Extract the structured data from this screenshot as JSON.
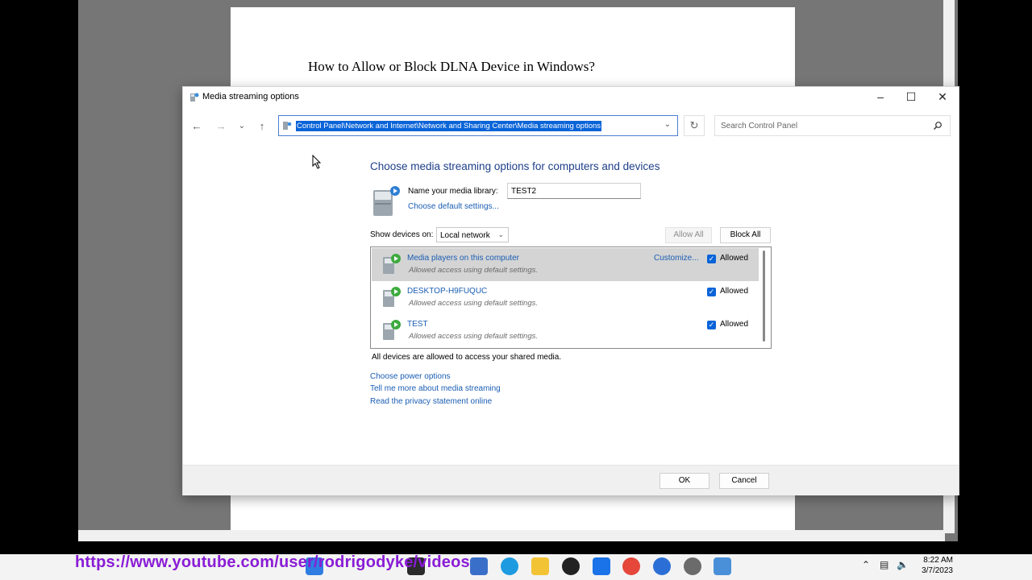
{
  "background_document": {
    "title": "How to Allow or Block DLNA Device in Windows?"
  },
  "dialog": {
    "title": "Media streaming options",
    "address": "Control Panel\\Network and Internet\\Network and Sharing Center\\Media streaming options",
    "search_placeholder": "Search Control Panel",
    "heading": "Choose media streaming options for computers and devices",
    "library_label": "Name your media library:",
    "library_value": "TEST2",
    "choose_default_link": "Choose default settings...",
    "show_devices_label": "Show devices on:",
    "show_devices_value": "Local network",
    "allow_all": "Allow All",
    "block_all": "Block All",
    "devices": [
      {
        "name": "Media players on this computer",
        "status": "Allowed access using default settings.",
        "customize": "Customize...",
        "allowed_label": "Allowed",
        "checked": true
      },
      {
        "name": "DESKTOP-H9FUQUC",
        "status": "Allowed access using default settings.",
        "allowed_label": "Allowed",
        "checked": true
      },
      {
        "name": "TEST",
        "status": "Allowed access using default settings.",
        "allowed_label": "Allowed",
        "checked": true
      }
    ],
    "all_devices_text": "All devices are allowed to access your shared media.",
    "links": {
      "power": "Choose power options",
      "tell_more": "Tell me more about media streaming",
      "privacy": "Read the privacy statement online"
    },
    "ok": "OK",
    "cancel": "Cancel"
  },
  "overlay": {
    "youtube_url": "https://www.youtube.com/user/rodrigodyke/videos"
  },
  "tray": {
    "time": "8:22 AM",
    "date": "3/7/2023"
  },
  "colors": {
    "accent": "#0a64d8",
    "link": "#1a5db3",
    "heading": "#1e3f8a",
    "overlay_text": "#8a1cd6"
  },
  "icons": {
    "title": "media-streaming-icon",
    "back": "back-arrow-icon",
    "forward": "forward-arrow-icon",
    "recent": "chevron-down-icon",
    "up": "up-arrow-icon",
    "refresh": "refresh-icon",
    "search": "search-icon"
  }
}
